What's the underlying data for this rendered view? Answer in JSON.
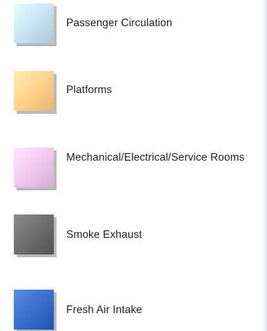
{
  "legend": {
    "items": [
      {
        "label": "Passenger Circulation",
        "color": "#c8e3f2"
      },
      {
        "label": "Platforms",
        "color": "#fed28c"
      },
      {
        "label": "Mechanical/Electrical/Service Rooms",
        "color": "#f1c9ee"
      },
      {
        "label": "Smoke Exhaust",
        "color": "#6e6e6e"
      },
      {
        "label": "Fresh Air Intake",
        "color": "#3a6fce"
      }
    ]
  }
}
